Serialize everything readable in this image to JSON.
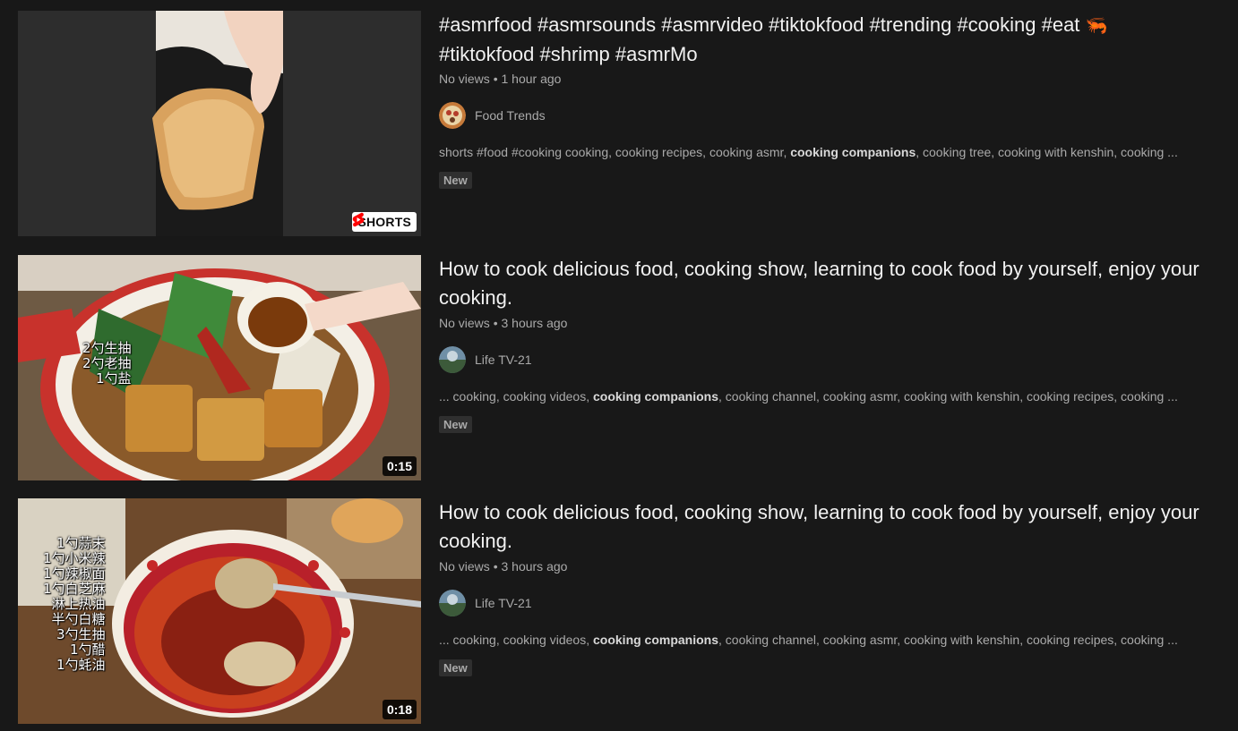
{
  "videos": [
    {
      "title": "#asmrfood #asmrsounds #asmrvideo #tiktokfood #trending #cooking #eat",
      "title_line2": "#tiktokfood #shrimp #asmrMo",
      "title_icon": "🦐",
      "views": "No views",
      "age": "1 hour ago",
      "channel": "Food Trends",
      "snippet_before": "shorts #food #cooking cooking, cooking recipes, cooking asmr, ",
      "snippet_bold": "cooking companions",
      "snippet_after": ", cooking tree, cooking with kenshin, cooking ...",
      "badge": "New",
      "overlay": "SHORTS"
    },
    {
      "title": "How to cook delicious food, cooking show, learning to cook food by yourself, enjoy your cooking.",
      "views": "No views",
      "age": "3 hours ago",
      "channel": "Life TV-21",
      "snippet_before": "... cooking, cooking videos, ",
      "snippet_bold": "cooking companions",
      "snippet_after": ", cooking channel, cooking asmr, cooking with kenshin, cooking recipes, cooking ...",
      "badge": "New",
      "duration": "0:15",
      "caption_lines": [
        "2勺生抽",
        "2勺老抽",
        "1勺盐"
      ]
    },
    {
      "title": "How to cook delicious food, cooking show, learning to cook food by yourself, enjoy your cooking.",
      "views": "No views",
      "age": "3 hours ago",
      "channel": "Life TV-21",
      "snippet_before": "... cooking, cooking videos, ",
      "snippet_bold": "cooking companions",
      "snippet_after": ", cooking channel, cooking asmr, cooking with kenshin, cooking recipes, cooking ...",
      "badge": "New",
      "duration": "0:18",
      "caption_lines": [
        "1勺蒜末",
        "1勺小米辣",
        "1勺辣椒面",
        "1勺白芝麻",
        "淋上热油",
        "半勺白糖",
        "3勺生抽",
        "1勺醋",
        "1勺蚝油"
      ]
    }
  ],
  "meta_separator": "•"
}
